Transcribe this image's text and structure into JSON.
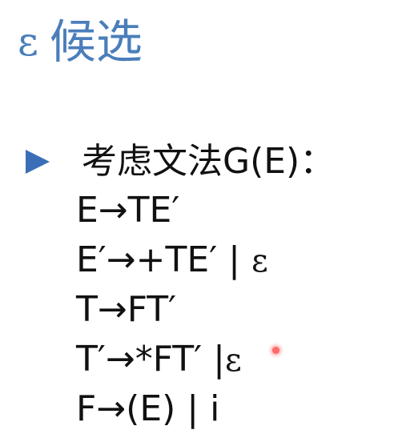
{
  "title": {
    "epsilon": "ε",
    "text": "候选"
  },
  "bullet": {
    "icon": "triangle-right-icon",
    "color": "#3a6fb7",
    "text": "考虑文法G(E)："
  },
  "rules": [
    {
      "text": "E→TE′",
      "eps": ""
    },
    {
      "text": "E′→+TE′ | ",
      "eps": "ε"
    },
    {
      "text": "T→FT′",
      "eps": ""
    },
    {
      "text": "T′→*FT′ |",
      "eps": "ε"
    },
    {
      "text": "F→(E) | i",
      "eps": ""
    }
  ],
  "colors": {
    "title": "#4a7ebb",
    "text": "#111111",
    "pointer": "#ff6a6a"
  }
}
